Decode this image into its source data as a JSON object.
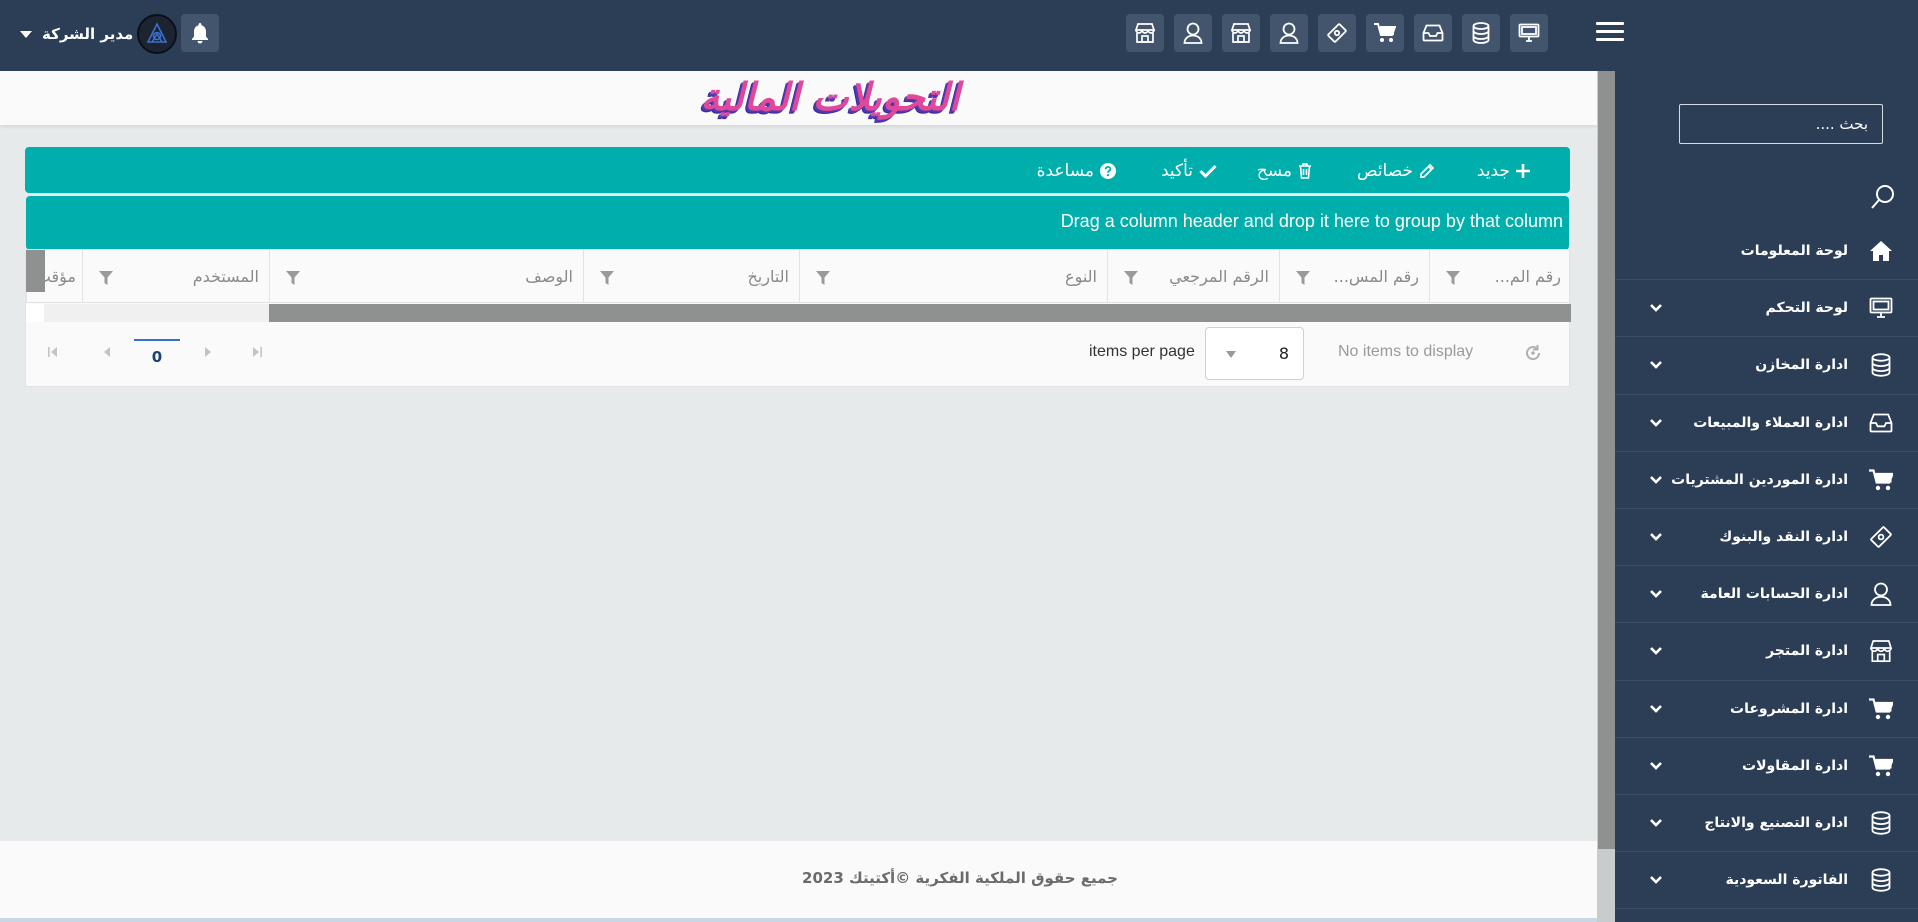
{
  "topbar": {
    "user_name": "مدير الشركة",
    "icons": [
      "monitor-icon",
      "database-icon",
      "inbox-icon",
      "cart-icon",
      "money-icon",
      "user-icon",
      "store-icon",
      "user-icon",
      "store-icon"
    ]
  },
  "sidebar": {
    "search_placeholder": "بحث ....",
    "items": [
      {
        "label": "لوحة المعلومات",
        "icon": "home-icon",
        "has_children": false
      },
      {
        "label": "لوحة التحكم",
        "icon": "monitor-icon",
        "has_children": true
      },
      {
        "label": "ادارة المخازن",
        "icon": "database-icon",
        "has_children": true
      },
      {
        "label": "ادارة العملاء والمبيعات",
        "icon": "inbox-icon",
        "has_children": true
      },
      {
        "label": "ادارة الموردين المشتريات",
        "icon": "cart-icon",
        "has_children": true
      },
      {
        "label": "ادارة النقد والبنوك",
        "icon": "money-icon",
        "has_children": true
      },
      {
        "label": "ادارة الحسابات العامة",
        "icon": "user-icon",
        "has_children": true
      },
      {
        "label": "ادارة المتجر",
        "icon": "store-icon",
        "has_children": true
      },
      {
        "label": "ادارة المشروعات",
        "icon": "cart-icon",
        "has_children": true
      },
      {
        "label": "ادارة المقاولات",
        "icon": "cart-icon",
        "has_children": true
      },
      {
        "label": "ادارة التصنيع والانتاج",
        "icon": "database-icon",
        "has_children": true
      },
      {
        "label": "الفاتورة السعودية",
        "icon": "database-icon",
        "has_children": true
      }
    ]
  },
  "main": {
    "page_title": "التحويلات المالية",
    "toolbar": {
      "new_label": "جديد",
      "properties_label": "خصائص",
      "delete_label": "مسح",
      "confirm_label": "تأكيد",
      "help_label": "مساعدة"
    },
    "group_hint": "Drag a column header and drop it here to group by that column",
    "columns": [
      "رقم الم...",
      "رقم المس...",
      "الرقم المرجعي",
      "النوع",
      "التاريخ",
      "الوصف",
      "المستخدم",
      "مؤقت"
    ],
    "pager": {
      "current_page": "0",
      "items_per_page": "8",
      "items_per_page_label": "items per page",
      "status": "No items to display"
    }
  },
  "footer": {
    "text": "جميع حقوق الملكية الفكرية ©أكتيتك 2023"
  },
  "colors": {
    "nav_bg": "#2c3e56",
    "accent": "#00aeac",
    "title_pink": "#e0489a",
    "title_shadow": "#4d3bb5"
  }
}
